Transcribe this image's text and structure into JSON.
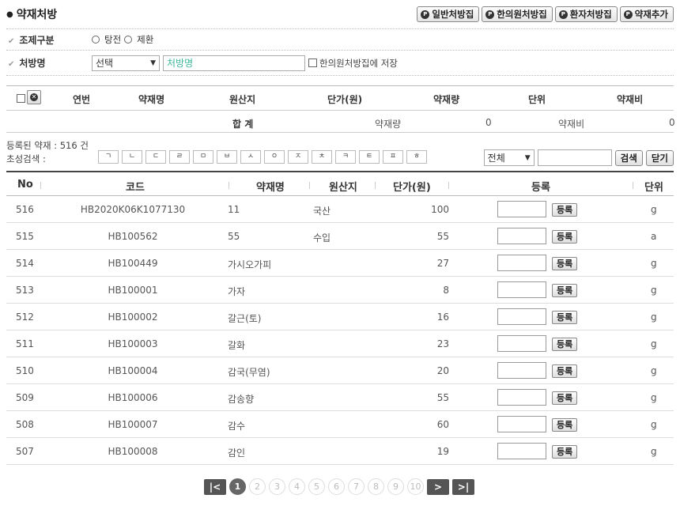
{
  "header": {
    "title": "약재처방",
    "buttons": [
      "일반처방집",
      "한의원처방집",
      "환자처방집",
      "약재추가"
    ]
  },
  "form": {
    "prep_label": "조제구분",
    "prep_options": [
      "탕전",
      "제환"
    ],
    "rx_label": "처방명",
    "rx_select": "선택",
    "rx_placeholder": "처방명",
    "save_label": "한의원처방집에 저장"
  },
  "rx_table": {
    "columns": [
      "연번",
      "약재명",
      "원산지",
      "단가(원)",
      "약재량",
      "단위",
      "약재비"
    ],
    "sum_label": "합 계",
    "sum_qty_label": "약재량",
    "sum_qty": "0",
    "sum_cost_label": "약재비",
    "sum_cost": "0"
  },
  "herb_search": {
    "count_text": "등록된 약재 : 516 건",
    "chosung_label": "초성검색 :",
    "chosung": [
      "ㄱ",
      "ㄴ",
      "ㄷ",
      "ㄹ",
      "ㅁ",
      "ㅂ",
      "ㅅ",
      "ㅇ",
      "ㅈ",
      "ㅊ",
      "ㅋ",
      "ㅌ",
      "ㅍ",
      "ㅎ"
    ],
    "filter_value": "전체",
    "search_button": "검색",
    "close_button": "닫기"
  },
  "herb_list": {
    "columns": [
      "No",
      "코드",
      "약재명",
      "원산지",
      "단가(원)",
      "등록",
      "단위"
    ],
    "register_label": "등록",
    "rows": [
      {
        "no": "516",
        "code": "HB2020K06K1077130",
        "name": "11",
        "origin": "국산",
        "price": "100",
        "unit": "g"
      },
      {
        "no": "515",
        "code": "HB100562",
        "name": "55",
        "origin": "수입",
        "price": "55",
        "unit": "a"
      },
      {
        "no": "514",
        "code": "HB100449",
        "name": "가시오가피",
        "origin": "",
        "price": "27",
        "unit": "g"
      },
      {
        "no": "513",
        "code": "HB100001",
        "name": "가자",
        "origin": "",
        "price": "8",
        "unit": "g"
      },
      {
        "no": "512",
        "code": "HB100002",
        "name": "갈근(토)",
        "origin": "",
        "price": "16",
        "unit": "g"
      },
      {
        "no": "511",
        "code": "HB100003",
        "name": "갈화",
        "origin": "",
        "price": "23",
        "unit": "g"
      },
      {
        "no": "510",
        "code": "HB100004",
        "name": "감국(무염)",
        "origin": "",
        "price": "20",
        "unit": "g"
      },
      {
        "no": "509",
        "code": "HB100006",
        "name": "감송향",
        "origin": "",
        "price": "55",
        "unit": "g"
      },
      {
        "no": "508",
        "code": "HB100007",
        "name": "감수",
        "origin": "",
        "price": "60",
        "unit": "g"
      },
      {
        "no": "507",
        "code": "HB100008",
        "name": "감인",
        "origin": "",
        "price": "19",
        "unit": "g"
      }
    ]
  },
  "pager": {
    "first": "|<",
    "next": ">",
    "last": ">|",
    "pages": [
      "1",
      "2",
      "3",
      "4",
      "5",
      "6",
      "7",
      "8",
      "9",
      "10"
    ],
    "current": "1"
  }
}
